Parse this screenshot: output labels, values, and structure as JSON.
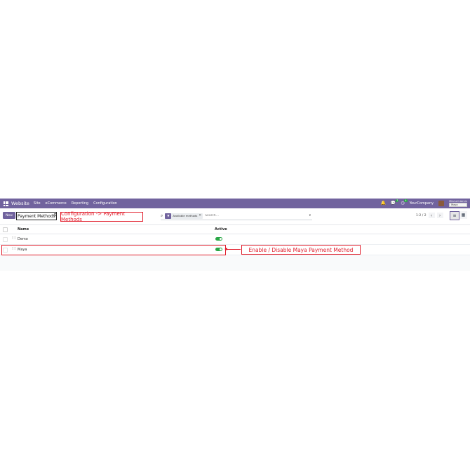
{
  "navbar": {
    "brand": "Website",
    "menu": [
      "Site",
      "eCommerce",
      "Reporting",
      "Configuration"
    ],
    "chat_badge": "7",
    "activity_badge": "4",
    "company": "YourCompany",
    "user_name": "Mitchell Admin",
    "db_tag": "Maya"
  },
  "control_panel": {
    "new_label": "New",
    "title": "Payment Methods",
    "facet_label": "Available methods",
    "search_placeholder": "Search...",
    "pager": "1-2 / 2"
  },
  "annotations": {
    "config_path": "Configuration -> Payment Methods",
    "maya_hint": "Enable / Disable Maya Payment Method"
  },
  "list": {
    "columns": {
      "name": "Name",
      "active": "Active"
    },
    "rows": [
      {
        "name": "Demo",
        "active": true
      },
      {
        "name": "Maya",
        "active": true
      }
    ]
  },
  "colors": {
    "navbar": "#71639e",
    "toggle_on": "#28a745",
    "annotation": "#e11d2b"
  },
  "icons": [
    "apps-icon",
    "bell-icon",
    "chat-icon",
    "clock-icon",
    "gear-icon",
    "search-icon",
    "filter-icon",
    "chevron-left-icon",
    "chevron-right-icon",
    "list-view-icon",
    "kanban-view-icon",
    "drag-handle-icon"
  ]
}
